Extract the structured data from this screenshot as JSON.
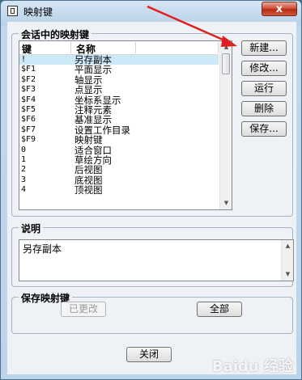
{
  "window": {
    "title": "映射键",
    "close_label": "x"
  },
  "session_group": {
    "legend": "会话中的映射键",
    "columns": [
      "键",
      "名称"
    ],
    "rows": [
      {
        "key": "!",
        "name": "另存副本",
        "selected": true
      },
      {
        "key": "$F1",
        "name": "平面显示"
      },
      {
        "key": "$F2",
        "name": "轴显示"
      },
      {
        "key": "$F3",
        "name": "点显示"
      },
      {
        "key": "$F4",
        "name": "坐标系显示"
      },
      {
        "key": "$F5",
        "name": "注释元素"
      },
      {
        "key": "$F6",
        "name": "基准显示"
      },
      {
        "key": "$F7",
        "name": "设置工作目录"
      },
      {
        "key": "$F9",
        "name": "映射键"
      },
      {
        "key": "0",
        "name": "适合窗口"
      },
      {
        "key": "1",
        "name": "草绘方向"
      },
      {
        "key": "2",
        "name": "后视图"
      },
      {
        "key": "3",
        "name": "底视图"
      },
      {
        "key": "4",
        "name": "顶视图"
      }
    ],
    "buttons": {
      "new": "新建...",
      "modify": "修改...",
      "run": "运行",
      "delete": "删除",
      "save": "保存..."
    }
  },
  "description": {
    "legend": "说明",
    "text": "另存副本"
  },
  "save_group": {
    "legend": "保存映射键",
    "changed": "已更改",
    "all": "全部"
  },
  "close_button": "关闭",
  "watermark": "Baidu 经验",
  "colors": {
    "annotation_arrow": "#e02020",
    "selected_row": "#cde8f7"
  }
}
